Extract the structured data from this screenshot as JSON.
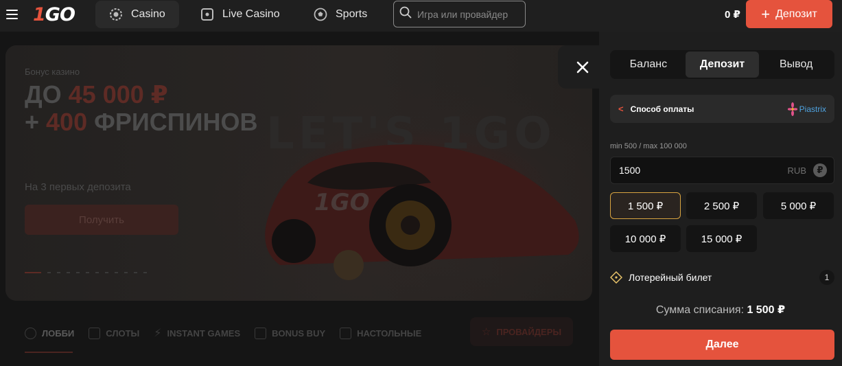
{
  "header": {
    "logo": {
      "part1": "1",
      "part2": "GO"
    },
    "nav": [
      {
        "label": "Casino",
        "icon": "casino-chip-icon"
      },
      {
        "label": "Live Casino",
        "icon": "live-dice-icon"
      },
      {
        "label": "Sports",
        "icon": "soccer-ball-icon"
      }
    ],
    "search_placeholder": "Игра или провайдер",
    "balance": "0 ₽",
    "deposit_label": "Депозит"
  },
  "banner": {
    "subtitle": "Бонус казино",
    "line1_prefix": "ДО ",
    "line1_amount": "45 000 ₽",
    "line2_prefix": "+ ",
    "line2_amount": "400",
    "line2_suffix": " ФРИСПИНОВ",
    "note": "На 3 первых депозита",
    "button": "Получить",
    "slide_count": 12,
    "active_slide": 1
  },
  "categories": {
    "items": [
      {
        "label": "ЛОББИ",
        "icon": "lobby-icon"
      },
      {
        "label": "СЛОТЫ",
        "icon": "slots-icon"
      },
      {
        "label": "INSTANT GAMES",
        "icon": "lightning-icon"
      },
      {
        "label": "BONUS BUY",
        "icon": "bonus-buy-icon"
      },
      {
        "label": "НАСТОЛЬНЫЕ",
        "icon": "table-games-icon"
      }
    ],
    "providers": "ПРОВАЙДЕРЫ"
  },
  "panel": {
    "tabs": [
      "Баланс",
      "Депозит",
      "Вывод"
    ],
    "active_tab": "Депозит",
    "method_label": "Способ оплаты",
    "provider": "Piastrix",
    "limits": "min 500 / max 100 000",
    "amount_value": "1500",
    "currency": "RUB",
    "currency_symbol": "₽",
    "chips": [
      "1 500 ₽",
      "2 500 ₽",
      "5 000 ₽",
      "10 000 ₽",
      "15 000 ₽"
    ],
    "selected_chip": "1 500 ₽",
    "ticket_label": "Лотерейный билет",
    "ticket_count": "1",
    "total_label": "Сумма списания:",
    "total_value": "1 500 ₽",
    "next_label": "Далее"
  },
  "colors": {
    "accent": "#e5533d",
    "selected_border": "#d9a440",
    "panel_bg": "#1e1e1e",
    "header_bg": "#1f1f1f"
  }
}
